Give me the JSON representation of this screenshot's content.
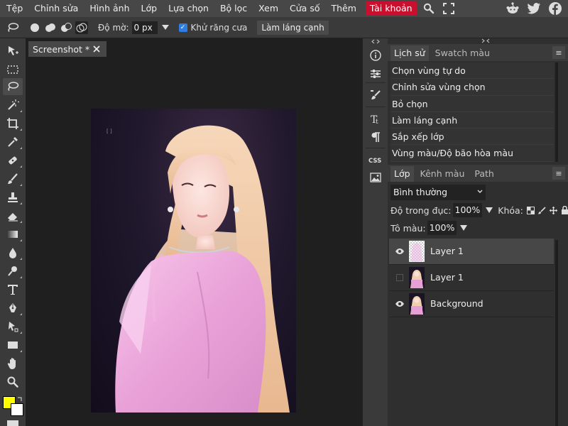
{
  "menu": {
    "items": [
      "Tệp",
      "Chỉnh sửa",
      "Hình ảnh",
      "Lớp",
      "Lựa chọn",
      "Bộ lọc",
      "Xem",
      "Cửa số",
      "Thêm"
    ],
    "account_label": "Tài khoản",
    "icons": [
      "search-icon",
      "fullscreen-icon"
    ],
    "social_icons": [
      "reddit-icon",
      "twitter-icon",
      "facebook-icon"
    ]
  },
  "options": {
    "feather_label": "Độ mờ:",
    "feather_value": "0 px",
    "antialias_checked": true,
    "antialias_label": "Khử răng cưa",
    "refine_button": "Làm láng cạnh"
  },
  "document": {
    "tab_title": "Screenshot *",
    "canvas_watermark": "[ ]"
  },
  "history_panel": {
    "tabs": [
      "Lịch sử",
      "Swatch màu"
    ],
    "active_tab": 0,
    "items": [
      "Chọn vùng tự do",
      "Chỉnh sửa vùng chọn",
      "Bỏ chọn",
      "Làm láng cạnh",
      "Sắp xếp lớp",
      "Vùng màu/Độ bão hòa màu"
    ]
  },
  "layers_panel": {
    "tabs": [
      "Lớp",
      "Kênh màu",
      "Path"
    ],
    "active_tab": 0,
    "blend_mode": "Bình thường",
    "opacity_label": "Độ trong đục:",
    "opacity_value": "100%",
    "lock_label": "Khóa:",
    "fill_label": "Tô màu:",
    "fill_value": "100%",
    "layers": [
      {
        "name": "Layer 1",
        "visible": true,
        "selected": true
      },
      {
        "name": "Layer 1",
        "visible": false,
        "selected": false
      },
      {
        "name": "Background",
        "visible": true,
        "selected": false
      }
    ]
  },
  "colors": {
    "foreground": "#ffff00",
    "background": "#ffffff",
    "accent": "#c8102e"
  }
}
